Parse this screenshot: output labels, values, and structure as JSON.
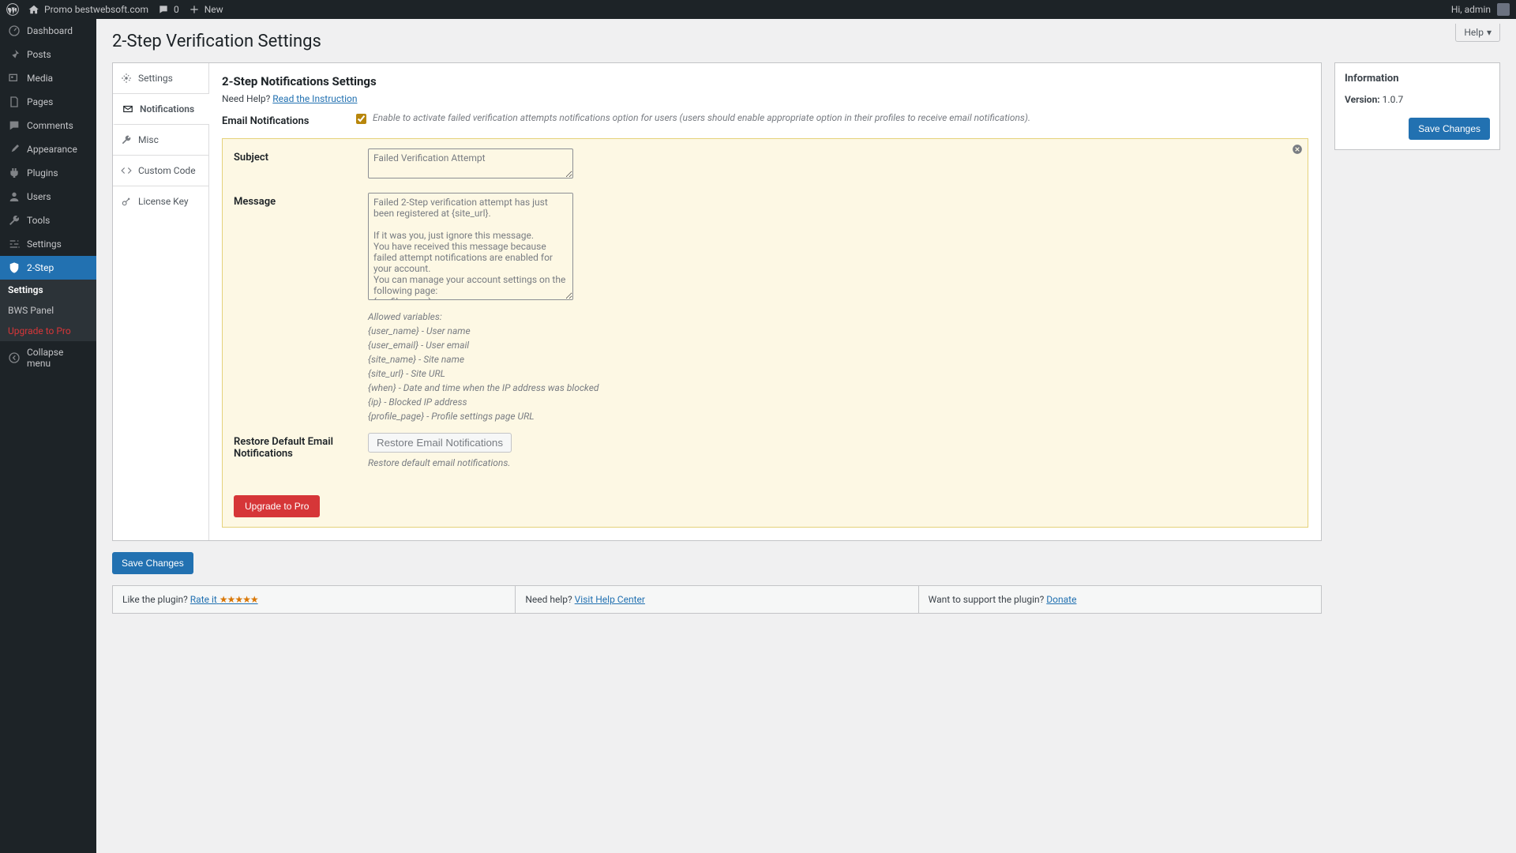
{
  "adminbar": {
    "site_name": "Promo bestwebsoft.com",
    "comments_count": "0",
    "new_label": "New",
    "greeting": "Hi, admin"
  },
  "sidebar": {
    "dashboard": "Dashboard",
    "posts": "Posts",
    "media": "Media",
    "pages": "Pages",
    "comments": "Comments",
    "appearance": "Appearance",
    "plugins": "Plugins",
    "users": "Users",
    "tools": "Tools",
    "settings": "Settings",
    "twostep": "2-Step",
    "sub_settings": "Settings",
    "sub_bws": "BWS Panel",
    "sub_upgrade": "Upgrade to Pro",
    "collapse": "Collapse menu"
  },
  "page": {
    "title": "2-Step Verification Settings",
    "help": "Help"
  },
  "tabs": {
    "settings": "Settings",
    "notifications": "Notifications",
    "misc": "Misc",
    "custom_code": "Custom Code",
    "license": "License Key"
  },
  "section": {
    "heading": "2-Step Notifications Settings",
    "need_help": "Need Help?",
    "read_instruction": "Read the Instruction"
  },
  "form": {
    "email_notifications_label": "Email Notifications",
    "email_notifications_hint": "Enable to activate failed verification attempts notifications option for users (users should enable appropriate option in their profiles to receive email notifications).",
    "subject_label": "Subject",
    "subject_value": "Failed Verification Attempt",
    "message_label": "Message",
    "message_value": "Failed 2-Step verification attempt has just been registered at {site_url}.\n\nIf it was you, just ignore this message.\nYou have received this message because failed attempt notifications are enabled for your account.\nYou can manage your account settings on the following page:\n{profile_page}",
    "vars_heading": "Allowed variables:",
    "vars": {
      "user_name": "{user_name} - User name",
      "user_email": "{user_email} - User email",
      "site_name": "{site_name} - Site name",
      "site_url": "{site_url} - Site URL",
      "when": "{when} - Date and time when the IP address was blocked",
      "ip": "{ip} - Blocked IP address",
      "profile_page": "{profile_page} - Profile settings page URL"
    },
    "restore_label": "Restore Default Email Notifications",
    "restore_button": "Restore Email Notifications",
    "restore_hint": "Restore default email notifications.",
    "upgrade_button": "Upgrade to Pro",
    "save_button": "Save Changes"
  },
  "footer": {
    "like": "Like the plugin?",
    "rate": "Rate it",
    "need_help": "Need help?",
    "visit_help": "Visit Help Center",
    "support": "Want to support the plugin?",
    "donate": "Donate"
  },
  "info": {
    "heading": "Information",
    "version_label": "Version:",
    "version_value": "1.0.7",
    "save": "Save Changes"
  }
}
